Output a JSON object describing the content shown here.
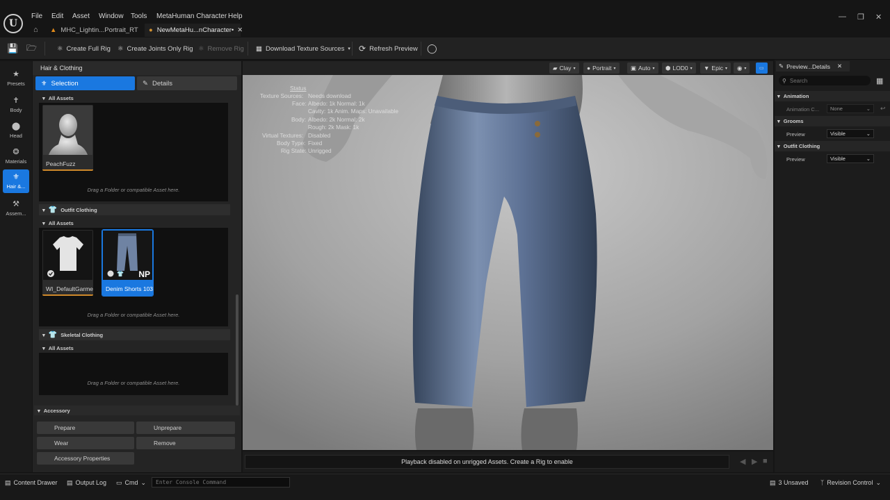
{
  "menu": {
    "items": [
      "File",
      "Edit",
      "Asset",
      "Window",
      "Tools",
      "MetaHuman Character",
      "Help"
    ]
  },
  "tabs": [
    {
      "label": "MHC_Lightin...Portrait_RT"
    },
    {
      "label": "NewMetaHu...nCharacter•"
    }
  ],
  "toolbar": {
    "create_full_rig": "Create Full Rig",
    "create_joints_only_rig": "Create Joints Only Rig",
    "remove_rig": "Remove Rig",
    "download_texture_sources": "Download Texture Sources",
    "refresh_preview": "Refresh Preview"
  },
  "left_tools": [
    {
      "label": "Presets"
    },
    {
      "label": "Body"
    },
    {
      "label": "Head"
    },
    {
      "label": "Materials"
    },
    {
      "label": "Hair &..."
    },
    {
      "label": "Assem..."
    }
  ],
  "panel": {
    "title": "Hair & Clothing",
    "selection_tab": "Selection",
    "details_tab": "Details",
    "all_assets": "All Assets",
    "drop_hint": "Drag a Folder or compatible Asset here.",
    "groom_assets": [
      {
        "label": "PeachFuzz"
      }
    ],
    "outfit_title": "Outfit Clothing",
    "outfit_assets": [
      {
        "label": "WI_DefaultGarment"
      },
      {
        "label": "Denim Shorts 103",
        "badge": "NP"
      }
    ],
    "skeletal_title": "Skeletal Clothing",
    "accessory_title": "Accessory",
    "buttons": {
      "prepare": "Prepare",
      "unprepare": "Unprepare",
      "wear": "Wear",
      "remove": "Remove",
      "accessory_properties": "Accessory Properties"
    }
  },
  "viewport": {
    "buttons": {
      "clay": "Clay",
      "portrait": "Portrait",
      "auto": "Auto",
      "lod": "LOD0",
      "epic": "Epic"
    },
    "status": {
      "title": "Status",
      "texture_sources_label": "Texture Sources:",
      "texture_sources_value": "Needs download",
      "face_label": "Face:",
      "face_value": "Albedo: 1k Normal: 1k",
      "face_cavity": "Cavity: 1k  Anim. Maps: Unavailable",
      "body_label": "Body:",
      "body_value": "Albedo: 2k Normal: 2k",
      "body_extra": "Rough: 2k Mask: 1k",
      "virtual_textures_label": "Virtual Textures:",
      "virtual_textures_value": "Disabled",
      "body_type_label": "Body Type:",
      "body_type_value": "Fixed",
      "rig_state_label": "Rig State:",
      "rig_state_value": "Unrigged"
    },
    "playback_message": "Playback disabled on unrigged Assets. Create a Rig to enable"
  },
  "details": {
    "tab": "Preview...Details",
    "search_placeholder": "Search",
    "animation": {
      "title": "Animation",
      "label": "Animation C...",
      "value": "None"
    },
    "grooms": {
      "title": "Grooms",
      "label": "Preview",
      "value": "Visible"
    },
    "outfit": {
      "title": "Outfit Clothing",
      "label": "Preview",
      "value": "Visible"
    }
  },
  "statusbar": {
    "content_drawer": "Content Drawer",
    "output_log": "Output Log",
    "cmd": "Cmd",
    "console_placeholder": "Enter Console Command",
    "unsaved": "3 Unsaved",
    "revision_control": "Revision Control"
  },
  "colors": {
    "accent": "#1a78e0",
    "denim": "#5b6f8c"
  }
}
